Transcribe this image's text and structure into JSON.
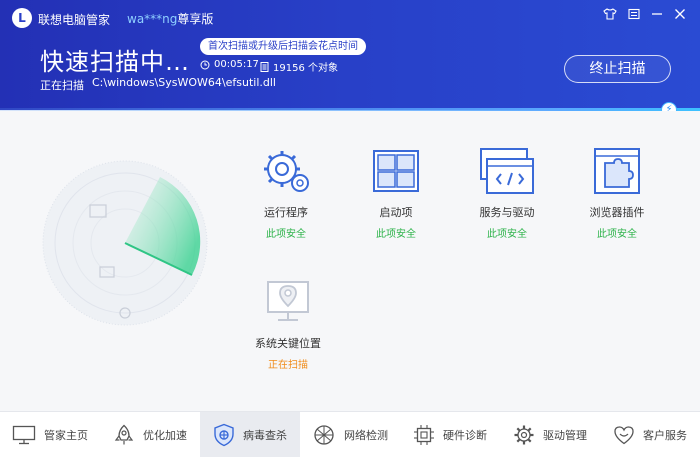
{
  "header": {
    "app_name": "联想电脑管家",
    "user_id": "wa***ng",
    "user_tier": "尊享版",
    "scan_title": "快速扫描中…",
    "promo": "首次扫描或升级后扫描会花点时间",
    "elapsed": "00:05:17",
    "file_count": "19156 个对象",
    "scan_path_label": "正在扫描",
    "scan_path": "C:\\windows\\SysWOW64\\efsutil.dll",
    "stop_label": "终止扫描"
  },
  "items": [
    {
      "label": "运行程序",
      "status": "此项安全",
      "icon": "gears-icon"
    },
    {
      "label": "启动项",
      "status": "此项安全",
      "icon": "windows-icon"
    },
    {
      "label": "服务与驱动",
      "status": "此项安全",
      "icon": "code-window-icon"
    },
    {
      "label": "浏览器插件",
      "status": "此项安全",
      "icon": "puzzle-icon"
    },
    {
      "label": "系统关键位置",
      "status": "正在扫描",
      "icon": "location-monitor-icon"
    }
  ],
  "nav": [
    {
      "label": "管家主页",
      "icon": "monitor-icon"
    },
    {
      "label": "优化加速",
      "icon": "rocket-icon"
    },
    {
      "label": "病毒查杀",
      "icon": "shield-icon"
    },
    {
      "label": "网络检测",
      "icon": "network-icon"
    },
    {
      "label": "硬件诊断",
      "icon": "chip-icon"
    },
    {
      "label": "驱动管理",
      "icon": "gear-icon"
    },
    {
      "label": "客户服务",
      "icon": "heart-icon"
    }
  ],
  "colors": {
    "header": "#2a3fc7",
    "safe": "#2db34a",
    "scanning": "#f08c1a",
    "accent": "#3a6ad8"
  }
}
